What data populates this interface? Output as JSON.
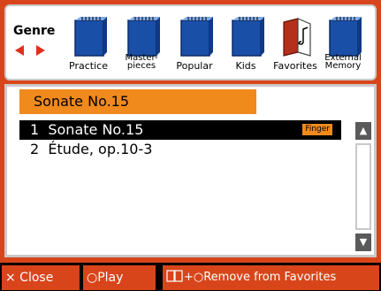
{
  "genre": {
    "label": "Genre",
    "items": [
      {
        "label": "Practice",
        "two_line": false,
        "icon": "blue-book-icon"
      },
      {
        "label": "Master-\npieces",
        "two_line": true,
        "icon": "blue-book-icon"
      },
      {
        "label": "Popular",
        "two_line": false,
        "icon": "blue-book-icon"
      },
      {
        "label": "Kids",
        "two_line": false,
        "icon": "blue-book-icon"
      },
      {
        "label": "Favorites",
        "two_line": false,
        "icon": "favorites-book-icon"
      },
      {
        "label": "External\nMemory",
        "two_line": true,
        "icon": "blue-book-icon"
      }
    ]
  },
  "folder_title": "Sonate No.15",
  "songs": [
    {
      "label": "1  Sonate No.15",
      "badge": "Finger",
      "selected": true
    },
    {
      "label": "2  Étude, op.10-3",
      "badge": "",
      "selected": false
    }
  ],
  "bottom": {
    "close": "× Close",
    "play": "○Play",
    "remove": "+○Remove from Favorites"
  },
  "colors": {
    "accent": "#d8451b",
    "highlight": "#f08a1c",
    "book_blue": "#1a4fa8"
  }
}
